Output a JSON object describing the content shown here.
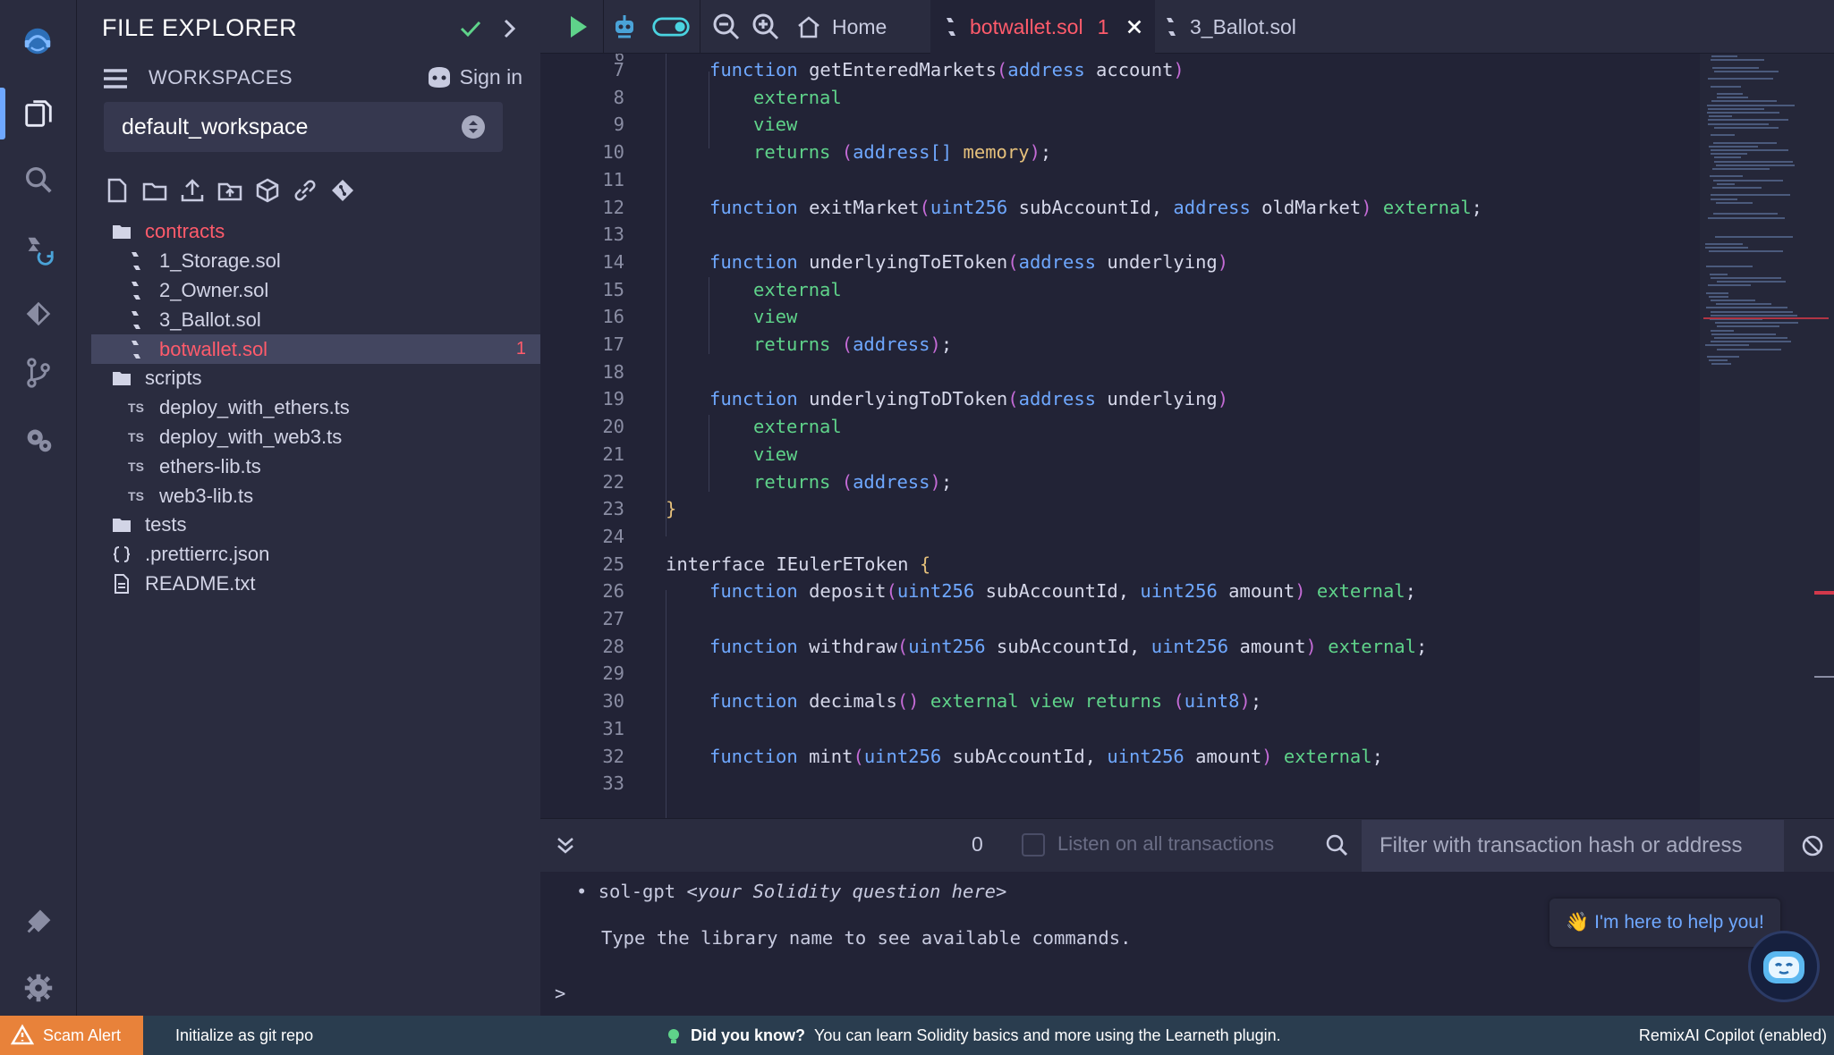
{
  "sidebar": {
    "title": "FILE EXPLORER",
    "workspaces_label": "WORKSPACES",
    "sign_in": "Sign in",
    "workspace": "default_workspace",
    "tree": [
      {
        "type": "folder",
        "label": "contracts",
        "depth": 0,
        "highlight": true
      },
      {
        "type": "sol",
        "label": "1_Storage.sol",
        "depth": 1
      },
      {
        "type": "sol",
        "label": "2_Owner.sol",
        "depth": 1
      },
      {
        "type": "sol",
        "label": "3_Ballot.sol",
        "depth": 1
      },
      {
        "type": "sol",
        "label": "botwallet.sol",
        "depth": 1,
        "selected": true,
        "count": "1"
      },
      {
        "type": "folder",
        "label": "scripts",
        "depth": 0
      },
      {
        "type": "ts",
        "label": "deploy_with_ethers.ts",
        "depth": 1
      },
      {
        "type": "ts",
        "label": "deploy_with_web3.ts",
        "depth": 1
      },
      {
        "type": "ts",
        "label": "ethers-lib.ts",
        "depth": 1
      },
      {
        "type": "ts",
        "label": "web3-lib.ts",
        "depth": 1
      },
      {
        "type": "folder",
        "label": "tests",
        "depth": 0
      },
      {
        "type": "json",
        "label": ".prettierrc.json",
        "depth": 0
      },
      {
        "type": "file",
        "label": "README.txt",
        "depth": 0
      }
    ],
    "ts_badge": "TS"
  },
  "tabs": {
    "home": "Home",
    "active_file": "botwallet.sol",
    "active_count": "1",
    "other_file": "3_Ballot.sol"
  },
  "editor": {
    "lines": [
      {
        "n": "7",
        "indent": 1,
        "tokens": [
          [
            "kw",
            "function "
          ],
          [
            "fn",
            "getEnteredMarkets"
          ],
          [
            "pu",
            "("
          ],
          [
            "ty",
            "address"
          ],
          [
            "fn",
            " account"
          ],
          [
            "pu",
            ")"
          ]
        ]
      },
      {
        "n": "8",
        "indent": 2,
        "tokens": [
          [
            "mod",
            "external"
          ]
        ]
      },
      {
        "n": "9",
        "indent": 2,
        "tokens": [
          [
            "mod",
            "view"
          ]
        ]
      },
      {
        "n": "10",
        "indent": 2,
        "tokens": [
          [
            "mod",
            "returns "
          ],
          [
            "pu",
            "("
          ],
          [
            "ty",
            "address[] "
          ],
          [
            "br",
            "memory"
          ],
          [
            "pu",
            ")"
          ],
          [
            "fn",
            ";"
          ]
        ]
      },
      {
        "n": "11",
        "indent": 0,
        "tokens": []
      },
      {
        "n": "12",
        "indent": 1,
        "tokens": [
          [
            "kw",
            "function "
          ],
          [
            "fn",
            "exitMarket"
          ],
          [
            "pu",
            "("
          ],
          [
            "ty",
            "uint256"
          ],
          [
            "fn",
            " subAccountId, "
          ],
          [
            "ty",
            "address"
          ],
          [
            "fn",
            " oldMarket"
          ],
          [
            "pu",
            ") "
          ],
          [
            "mod",
            "external"
          ],
          [
            "fn",
            ";"
          ]
        ]
      },
      {
        "n": "13",
        "indent": 0,
        "tokens": []
      },
      {
        "n": "14",
        "indent": 1,
        "tokens": [
          [
            "kw",
            "function "
          ],
          [
            "fn",
            "underlyingToEToken"
          ],
          [
            "pu",
            "("
          ],
          [
            "ty",
            "address"
          ],
          [
            "fn",
            " underlying"
          ],
          [
            "pu",
            ")"
          ]
        ]
      },
      {
        "n": "15",
        "indent": 2,
        "tokens": [
          [
            "mod",
            "external"
          ]
        ]
      },
      {
        "n": "16",
        "indent": 2,
        "tokens": [
          [
            "mod",
            "view"
          ]
        ]
      },
      {
        "n": "17",
        "indent": 2,
        "tokens": [
          [
            "mod",
            "returns "
          ],
          [
            "pu",
            "("
          ],
          [
            "ty",
            "address"
          ],
          [
            "pu",
            ")"
          ],
          [
            "fn",
            ";"
          ]
        ]
      },
      {
        "n": "18",
        "indent": 0,
        "tokens": []
      },
      {
        "n": "19",
        "indent": 1,
        "tokens": [
          [
            "kw",
            "function "
          ],
          [
            "fn",
            "underlyingToDToken"
          ],
          [
            "pu",
            "("
          ],
          [
            "ty",
            "address"
          ],
          [
            "fn",
            " underlying"
          ],
          [
            "pu",
            ")"
          ]
        ]
      },
      {
        "n": "20",
        "indent": 2,
        "tokens": [
          [
            "mod",
            "external"
          ]
        ]
      },
      {
        "n": "21",
        "indent": 2,
        "tokens": [
          [
            "mod",
            "view"
          ]
        ]
      },
      {
        "n": "22",
        "indent": 2,
        "tokens": [
          [
            "mod",
            "returns "
          ],
          [
            "pu",
            "("
          ],
          [
            "ty",
            "address"
          ],
          [
            "pu",
            ")"
          ],
          [
            "fn",
            ";"
          ]
        ]
      },
      {
        "n": "23",
        "indent": 0,
        "tokens": [
          [
            "br",
            "}"
          ]
        ]
      },
      {
        "n": "24",
        "indent": 0,
        "tokens": []
      },
      {
        "n": "25",
        "indent": 0,
        "tokens": [
          [
            "fn",
            "interface IEulerEToken "
          ],
          [
            "br",
            "{"
          ]
        ]
      },
      {
        "n": "26",
        "indent": 1,
        "tokens": [
          [
            "kw",
            "function "
          ],
          [
            "fn",
            "deposit"
          ],
          [
            "pu",
            "("
          ],
          [
            "ty",
            "uint256"
          ],
          [
            "fn",
            " subAccountId, "
          ],
          [
            "ty",
            "uint256"
          ],
          [
            "fn",
            " amount"
          ],
          [
            "pu",
            ") "
          ],
          [
            "mod",
            "external"
          ],
          [
            "fn",
            ";"
          ]
        ]
      },
      {
        "n": "27",
        "indent": 0,
        "tokens": []
      },
      {
        "n": "28",
        "indent": 1,
        "tokens": [
          [
            "kw",
            "function "
          ],
          [
            "fn",
            "withdraw"
          ],
          [
            "pu",
            "("
          ],
          [
            "ty",
            "uint256"
          ],
          [
            "fn",
            " subAccountId, "
          ],
          [
            "ty",
            "uint256"
          ],
          [
            "fn",
            " amount"
          ],
          [
            "pu",
            ") "
          ],
          [
            "mod",
            "external"
          ],
          [
            "fn",
            ";"
          ]
        ]
      },
      {
        "n": "29",
        "indent": 0,
        "tokens": []
      },
      {
        "n": "30",
        "indent": 1,
        "tokens": [
          [
            "kw",
            "function "
          ],
          [
            "fn",
            "decimals"
          ],
          [
            "pu",
            "() "
          ],
          [
            "mod",
            "external view returns "
          ],
          [
            "pu",
            "("
          ],
          [
            "ty",
            "uint8"
          ],
          [
            "pu",
            ")"
          ],
          [
            "fn",
            ";"
          ]
        ]
      },
      {
        "n": "31",
        "indent": 0,
        "tokens": []
      },
      {
        "n": "32",
        "indent": 1,
        "tokens": [
          [
            "kw",
            "function "
          ],
          [
            "fn",
            "mint"
          ],
          [
            "pu",
            "("
          ],
          [
            "ty",
            "uint256"
          ],
          [
            "fn",
            " subAccountId, "
          ],
          [
            "ty",
            "uint256"
          ],
          [
            "fn",
            " amount"
          ],
          [
            "pu",
            ") "
          ],
          [
            "mod",
            "external"
          ],
          [
            "fn",
            ";"
          ]
        ]
      },
      {
        "n": "33",
        "indent": 0,
        "tokens": []
      }
    ]
  },
  "terminal": {
    "count": "0",
    "listen_label": "Listen on all transactions",
    "filter_placeholder": "Filter with transaction hash or address",
    "line1_cmd": "sol-gpt ",
    "line1_arg": "<your Solidity question here>",
    "line2": "Type the library name to see available commands.",
    "prompt": ">",
    "ai_bubble": "👋 I'm here to help you!"
  },
  "status": {
    "scam_alert": "Scam Alert",
    "git_init": "Initialize as git repo",
    "did_you_know": "Did you know?",
    "tip": "You can learn Solidity basics and more using the Learneth plugin.",
    "copilot": "RemixAI Copilot (enabled)"
  },
  "colors": {
    "bg": "#222336",
    "panel": "#2a2c3f",
    "accent_blue": "#6fa8ff",
    "error_red": "#ff5b6b",
    "green": "#5fd38a",
    "scam_orange": "#e8823a",
    "status_bar": "#2a3d4f"
  }
}
